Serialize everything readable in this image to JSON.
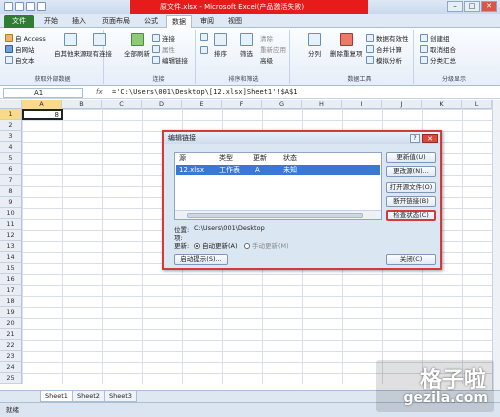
{
  "window": {
    "title": "原文件.xlsx - Microsoft Excel(产品激活失败)",
    "minimize": "–",
    "maximize": "□",
    "close": "✕"
  },
  "tabs": [
    "文件",
    "开始",
    "插入",
    "页面布局",
    "公式",
    "数据",
    "审阅",
    "视图"
  ],
  "active_tab": "数据",
  "ribbon": {
    "groups": {
      "external": "获取外部数据",
      "connections": "连接",
      "sort_filter": "排序和筛选",
      "data_tools": "数据工具",
      "outline": "分级显示"
    },
    "external": {
      "access": "自 Access",
      "web": "自网站",
      "text": "自文本",
      "other": "自其他来源",
      "existing": "现有连接"
    },
    "connections": {
      "refresh_all": "全部刷新",
      "connections": "连接",
      "properties": "属性",
      "edit_links": "编辑链接"
    },
    "sort_filter": {
      "sort": "排序",
      "filter": "筛选",
      "clear": "清除",
      "reapply": "重新应用",
      "advanced": "高级"
    },
    "data_tools": {
      "split": "分列",
      "remove_dup": "删除重复项",
      "validation": "数据有效性",
      "consolidate": "合并计算",
      "whatif": "模拟分析"
    },
    "outline": {
      "group": "创建组",
      "ungroup": "取消组合",
      "subtotal": "分类汇总"
    }
  },
  "formula_bar": {
    "name_box": "A1",
    "fx": "fx",
    "formula": "='C:\\Users\\001\\Desktop\\[12.xlsx]Sheet1'!$A$1"
  },
  "grid": {
    "columns": [
      "A",
      "B",
      "C",
      "D",
      "E",
      "F",
      "G",
      "H",
      "I",
      "J",
      "K",
      "L"
    ],
    "rows": [
      "1",
      "2",
      "3",
      "4",
      "5",
      "6",
      "7",
      "8",
      "9",
      "10",
      "11",
      "12",
      "13",
      "14",
      "15",
      "16",
      "17",
      "18",
      "19",
      "20",
      "21",
      "22",
      "23",
      "24",
      "25"
    ],
    "a1_value": "8"
  },
  "sheets": [
    "Sheet1",
    "Sheet2",
    "Sheet3"
  ],
  "status": "就绪",
  "dialog": {
    "title": "编辑链接",
    "help": "?",
    "close": "✕",
    "columns": {
      "source": "源",
      "type": "类型",
      "update": "更新",
      "status": "状态"
    },
    "rows": [
      {
        "source": "12.xlsx",
        "type": "工作表",
        "update": "A",
        "status": "未知"
      }
    ],
    "location_label": "位置:",
    "location_value": "C:\\Users\\001\\Desktop",
    "item_label": "项:",
    "update_label": "更新:",
    "auto_update": "自动更新(A)",
    "manual_update": "手动更新(M)",
    "buttons": {
      "update_values": "更新值(U)",
      "change_source": "更改源(N)...",
      "open_source": "打开源文件(O)",
      "break_link": "断开链接(B)",
      "check_status": "检查状态(C)",
      "startup_prompt": "启动提示(S)...",
      "close": "关闭(C)"
    }
  },
  "watermark": {
    "line1": "格子啦",
    "line2": "gezila.com"
  }
}
